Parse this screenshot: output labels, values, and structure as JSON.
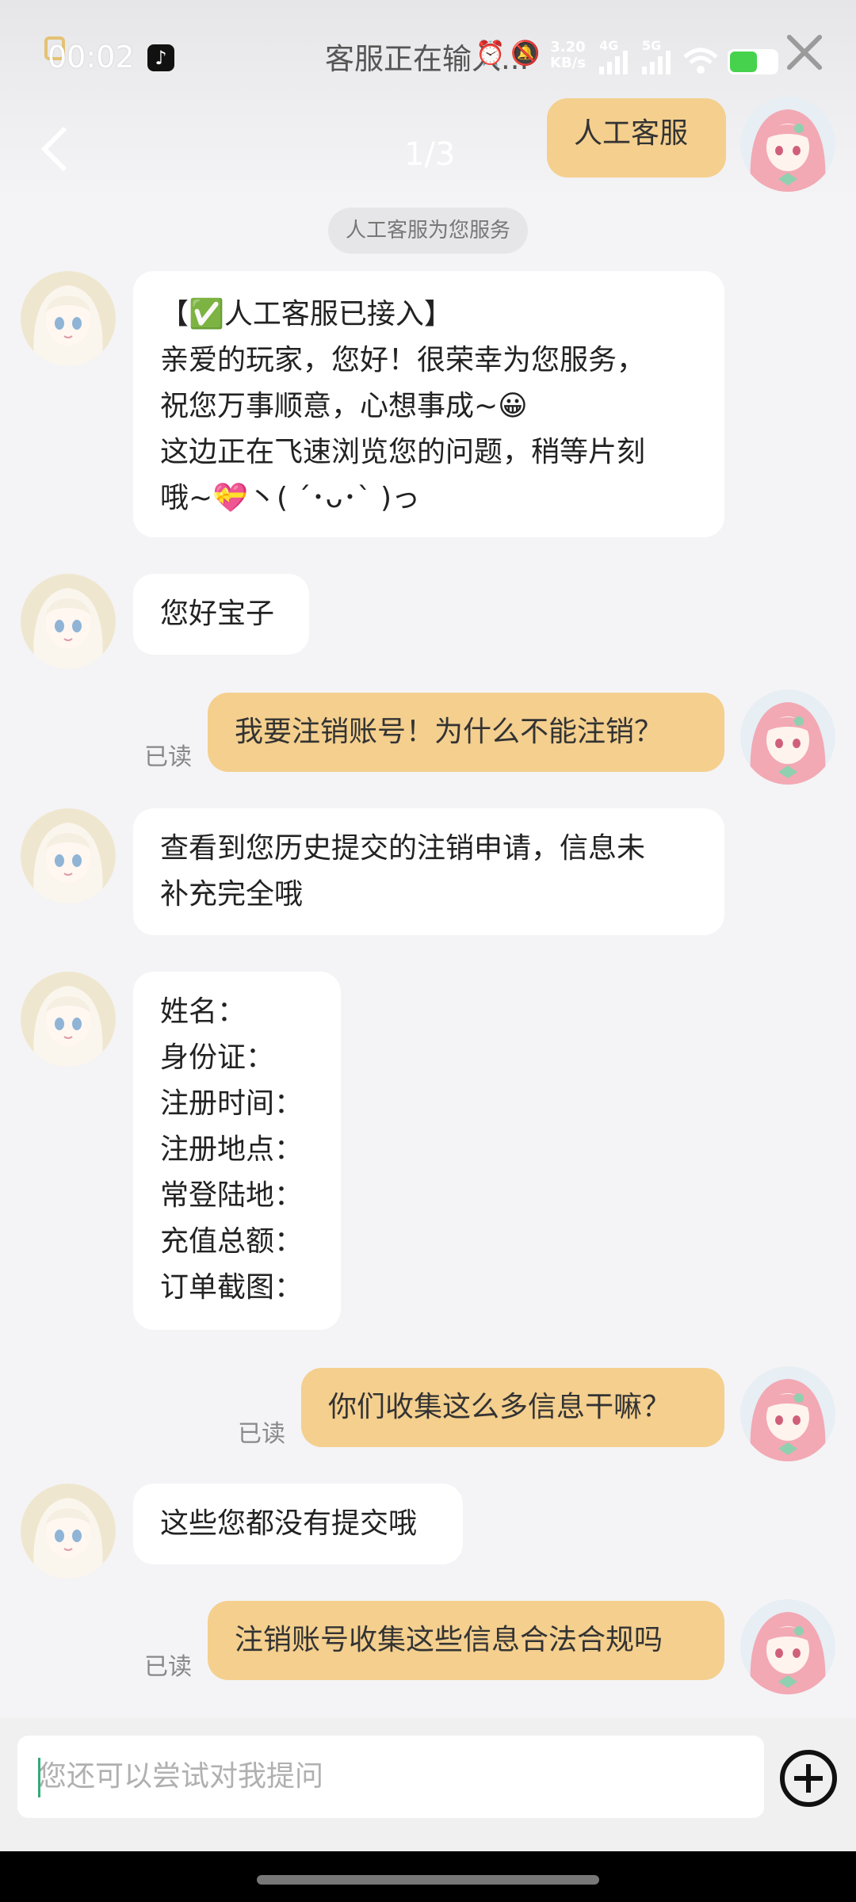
{
  "status_bar": {
    "time": "00:02",
    "typing_text": "客服正在输入...",
    "speed_value": "3.20",
    "speed_unit": "KB/s",
    "network_4g": "4G",
    "network_5g": "5G"
  },
  "header": {
    "page_counter": "1/3"
  },
  "messages": {
    "m1": {
      "text": "人工客服"
    },
    "sys": {
      "text": "人工客服为您服务"
    },
    "m2": {
      "line1": "【✅人工客服已接入】",
      "line2": "亲爱的玩家，您好！很荣幸为您服务，",
      "line3": "祝您万事顺意，心想事成~😀",
      "line4": "这边正在飞速浏览您的问题，稍等片刻",
      "line5": "哦~💝丶( ´･ᴗ･` )っ"
    },
    "m3": {
      "text": "您好宝子"
    },
    "m4": {
      "text": "我要注销账号！为什么不能注销？",
      "read": "已读"
    },
    "m5": {
      "line1": "查看到您历史提交的注销申请，信息未",
      "line2": "补充完全哦"
    },
    "m6": {
      "line1": "姓名：",
      "line2": "身份证：",
      "line3": "注册时间：",
      "line4": "注册地点：",
      "line5": "常登陆地：",
      "line6": "充值总额：",
      "line7": "订单截图："
    },
    "m7": {
      "text": "你们收集这么多信息干嘛？",
      "read": "已读"
    },
    "m8": {
      "text": "这些您都没有提交哦"
    },
    "m9": {
      "text": "注销账号收集这些信息合法合规吗",
      "read": "已读"
    }
  },
  "input": {
    "placeholder": "您还可以尝试对我提问"
  }
}
